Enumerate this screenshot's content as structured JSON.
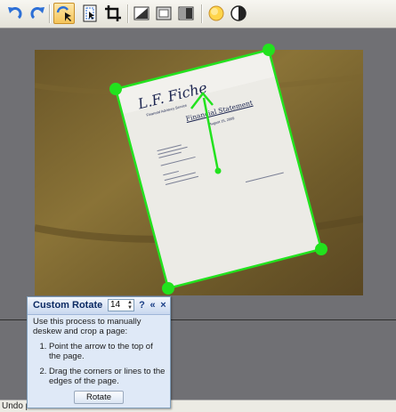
{
  "toolbar": {
    "buttons": [
      {
        "name": "undo",
        "icon": "undo-icon"
      },
      {
        "name": "redo",
        "icon": "redo-icon"
      },
      {
        "name": "custom-rotate",
        "icon": "rotate-select-icon",
        "active": true
      },
      {
        "name": "select-page",
        "icon": "select-page-icon"
      },
      {
        "name": "crop",
        "icon": "crop-icon"
      },
      {
        "name": "adjust-1",
        "icon": "contrast-square-icon"
      },
      {
        "name": "adjust-2",
        "icon": "frame-square-icon"
      },
      {
        "name": "adjust-3",
        "icon": "half-square-icon"
      },
      {
        "name": "brightness",
        "icon": "sun-circle-icon"
      },
      {
        "name": "contrast",
        "icon": "half-circle-icon"
      }
    ]
  },
  "document": {
    "logo": "L.F. Fiche",
    "subtitle": "Financial Advisory Service",
    "heading": "Financial Statement",
    "date": "August 15, 2009"
  },
  "panel": {
    "title": "Custom Rotate",
    "spin_value": "14",
    "help_glyph": "?",
    "collapse_glyph": "«",
    "close_glyph": "×",
    "intro": "Use this process to manually deskew and crop a page:",
    "steps": [
      "Point the arrow to the top of the page.",
      "Drag the corners or lines to the edges of the page."
    ],
    "button_label": "Rotate"
  },
  "status": {
    "text": "Undo pr"
  },
  "colors": {
    "handle": "#22e21e",
    "toolbar_active": "#f4c45a",
    "panel_bg": "#dfe9f7"
  }
}
